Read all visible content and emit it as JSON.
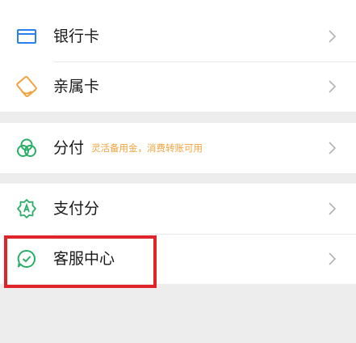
{
  "menu": {
    "bank_card": {
      "label": "银行卡",
      "icon": "bank-card-icon"
    },
    "family_card": {
      "label": "亲属卡",
      "icon": "family-card-icon"
    },
    "installment": {
      "label": "分付",
      "subtitle": "灵活备用金，消费转账可用",
      "icon": "installment-icon"
    },
    "pay_score": {
      "label": "支付分",
      "icon": "pay-score-icon"
    },
    "customer_service": {
      "label": "客服中心",
      "icon": "customer-service-icon"
    }
  },
  "colors": {
    "accent_green": "#2aae67",
    "bank_icon_blue": "#2c7ff0",
    "family_icon_orange": "#f0a33c",
    "highlight_red": "#e0242b",
    "subtitle_orange": "#f0a33c",
    "background_gray": "#ededed"
  }
}
